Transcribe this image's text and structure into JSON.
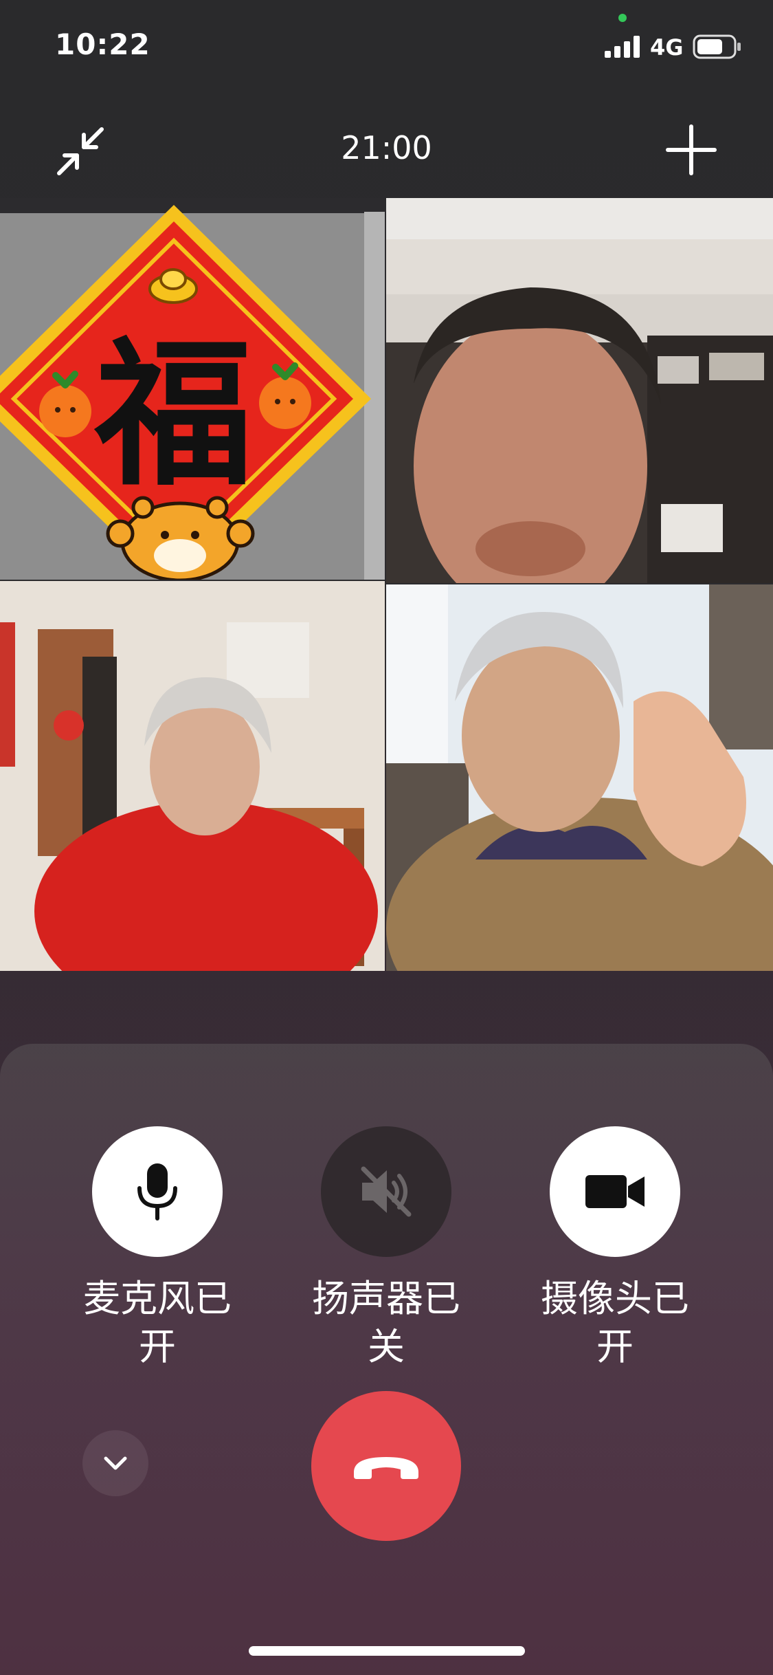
{
  "status_bar": {
    "time": "10:22",
    "network": "4G",
    "signal_icon": "signal-bars-icon",
    "battery_icon": "battery-icon"
  },
  "call": {
    "timer": "21:00",
    "minimize_icon": "minimize-arrows-icon",
    "add_icon": "plus-icon"
  },
  "participants": [
    {
      "name": "fu-sticker-avatar",
      "content": "福"
    },
    {
      "name": "participant-video-2"
    },
    {
      "name": "participant-video-3"
    },
    {
      "name": "participant-video-4"
    }
  ],
  "controls": {
    "microphone": {
      "label": "麦克风已开",
      "icon": "microphone-icon",
      "state": "on"
    },
    "speaker": {
      "label": "扬声器已关",
      "icon": "speaker-muted-icon",
      "state": "off"
    },
    "camera": {
      "label": "摄像头已开",
      "icon": "video-camera-icon",
      "state": "on"
    },
    "collapse_icon": "chevron-down-icon",
    "hangup_icon": "phone-hangup-icon"
  },
  "colors": {
    "hangup": "#e5484f",
    "button_on": "#ffffff",
    "privacy_dot": "#34c759"
  }
}
